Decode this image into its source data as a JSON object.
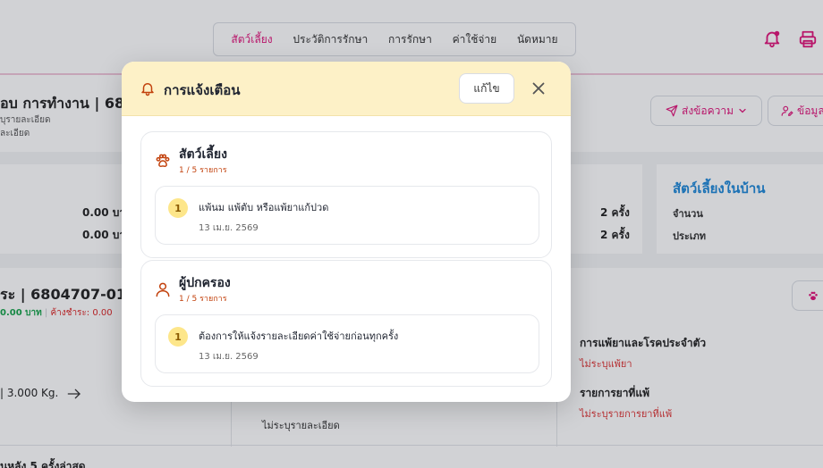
{
  "topnav": {
    "tabs": [
      {
        "label": "สัตว์เลี้ยง"
      },
      {
        "label": "ประวัติการรักษา"
      },
      {
        "label": "การรักษา"
      },
      {
        "label": "ค่าใช้จ่าย"
      },
      {
        "label": "นัดหมาย"
      }
    ]
  },
  "page": {
    "title": "อบ การทำงาน | 680",
    "subtitle1": "บุรายละเอียด",
    "subtitle2": "ละเอียด",
    "send_message": "ส่งข้อความ",
    "info_button": "ข้อมูล",
    "amount1": "0.00 บา",
    "amount2": "0.00 บา",
    "count1": "2 ครั้ง",
    "count2": "2 ครั้ง",
    "pets_home_title": "สัตว์เลี้ยงในบ้าน",
    "pets_home_label1": "จำนวน",
    "pets_home_label2": "ประเภท",
    "owner_title": "ระ | 6804707-01",
    "owner_paid": "0.00 บาท",
    "owner_due": "ค้างชำระ: 0.00",
    "weight": "| 3.000 Kg.",
    "allergy_label": "การแพ้ยาและโรคประจำตัว",
    "allergy_value": "ไม่ระบุแพ้ยา",
    "drug_label": "รายการยาที่แพ้",
    "drug_value": "ไม่ระบุรายการยาที่แพ้",
    "detail_value": "ไม่ระบุรายละเอียด",
    "history_label": "นหลัง 5 ครั้งล่าสุด"
  },
  "modal": {
    "title": "การแจ้งเตือน",
    "edit_label": "แก้ไข",
    "groups": [
      {
        "title": "สัตว์เลี้ยง",
        "count": "1 / 5 รายการ",
        "icon": "paw-icon",
        "items": [
          {
            "num": "1",
            "text": "แพ้นม แพ้ตับ หรือแพ้ยาแก้ปวด",
            "date": "13 เม.ย. 2569"
          }
        ]
      },
      {
        "title": "ผู้ปกครอง",
        "count": "1 / 5 รายการ",
        "icon": "user-icon",
        "items": [
          {
            "num": "1",
            "text": "ต้องการให้แจ้งรายละเอียดค่าใช้จ่ายก่อนทุกครั้ง",
            "date": "13 เม.ย. 2569"
          }
        ]
      }
    ]
  },
  "colors": {
    "accent": "#e0147a",
    "header_bg": "#fdf1c7",
    "count_text": "#c2410c",
    "badge_bg": "#fde68a",
    "link_blue": "#1d87d8",
    "danger": "#dd3333"
  }
}
